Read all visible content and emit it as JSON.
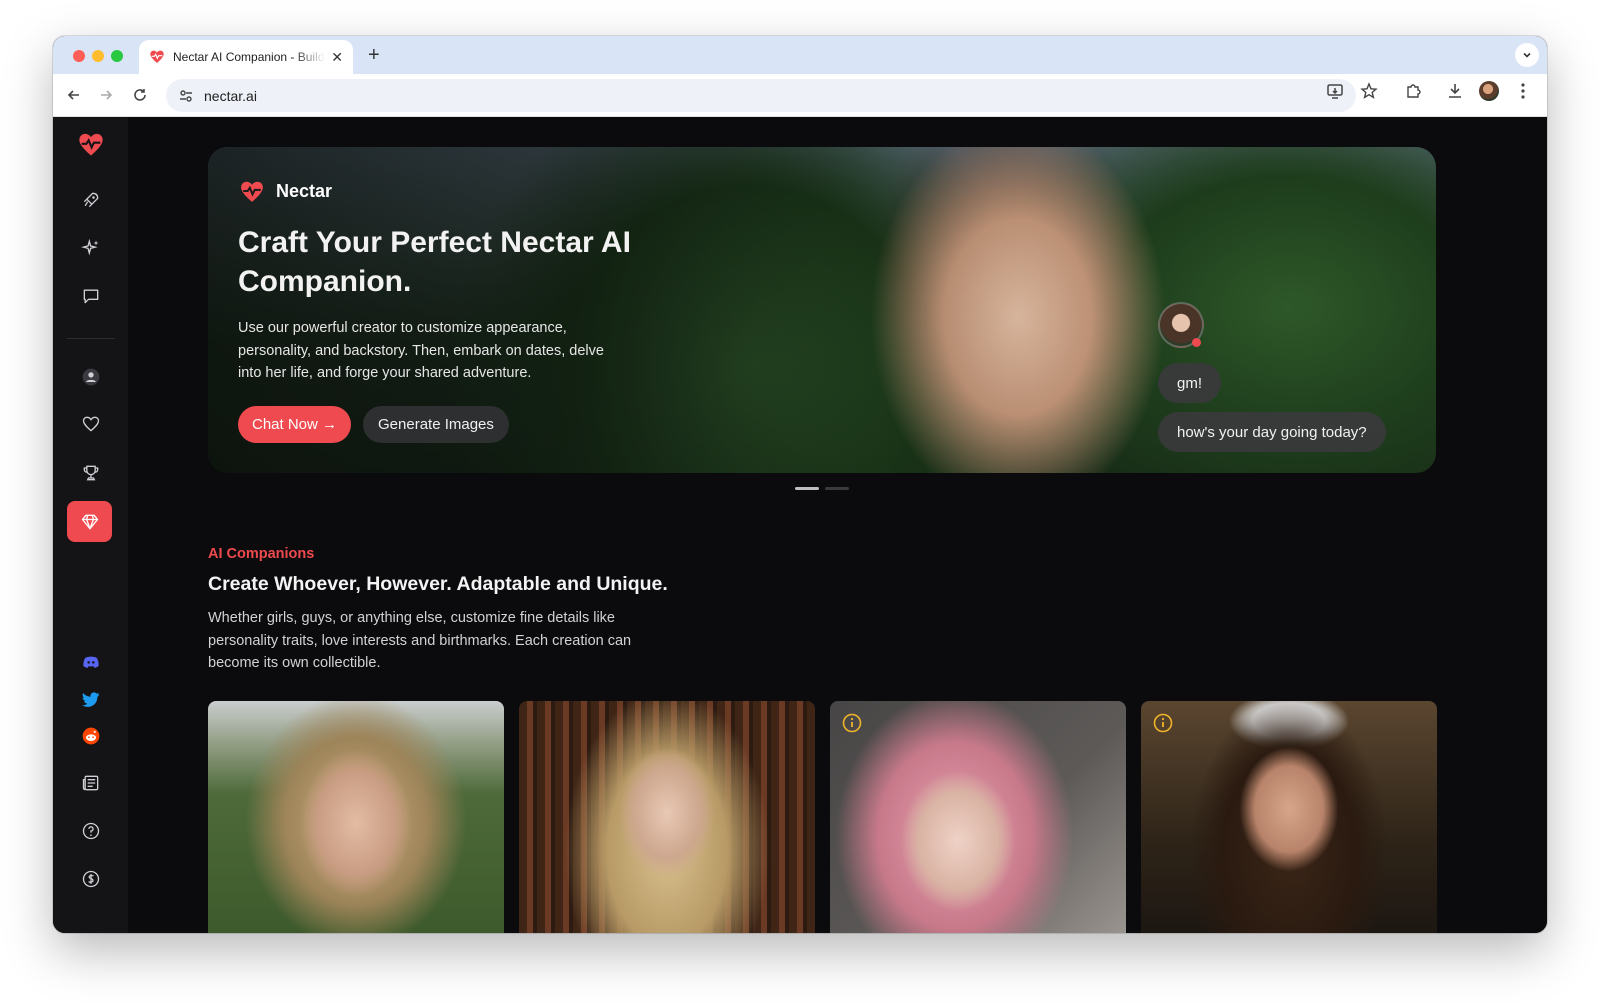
{
  "browser": {
    "tab_title": "Nectar AI Companion - Build Your Own",
    "url": "nectar.ai",
    "new_tab_symbol": "+",
    "close_symbol": "✕"
  },
  "hero": {
    "brand": "Nectar",
    "title": "Craft Your Perfect Nectar AI Companion.",
    "description": "Use our powerful creator to customize appearance, personality, and backstory. Then, embark on dates, delve into her life, and forge your shared adventure.",
    "chat_button": "Chat Now →",
    "generate_button": "Generate Images",
    "bubble_1": "gm!",
    "bubble_2": "how's your day going today?",
    "carousel_active": 1,
    "carousel_count": 2
  },
  "section": {
    "eyebrow": "AI Companions",
    "title": "Create Whoever, However. Adaptable and Unique.",
    "description": "Whether girls, guys, or anything else, customize fine details like personality traits, love interests and birthmarks. Each creation can become its own collectible."
  },
  "sidebar": {
    "items": [
      "logo-icon",
      "rocket-icon",
      "sparkles-icon",
      "chat-icon",
      "user-icon",
      "heart-icon",
      "trophy-icon",
      "gem-icon",
      "discord-icon",
      "twitter-icon",
      "reddit-icon",
      "news-icon",
      "help-icon",
      "coin-icon"
    ],
    "active": "gem-icon"
  },
  "colors": {
    "accent": "#ef4a4f",
    "page_bg": "#0b0b0e",
    "sidebar_bg": "#141417",
    "info_icon": "#f0b429"
  }
}
